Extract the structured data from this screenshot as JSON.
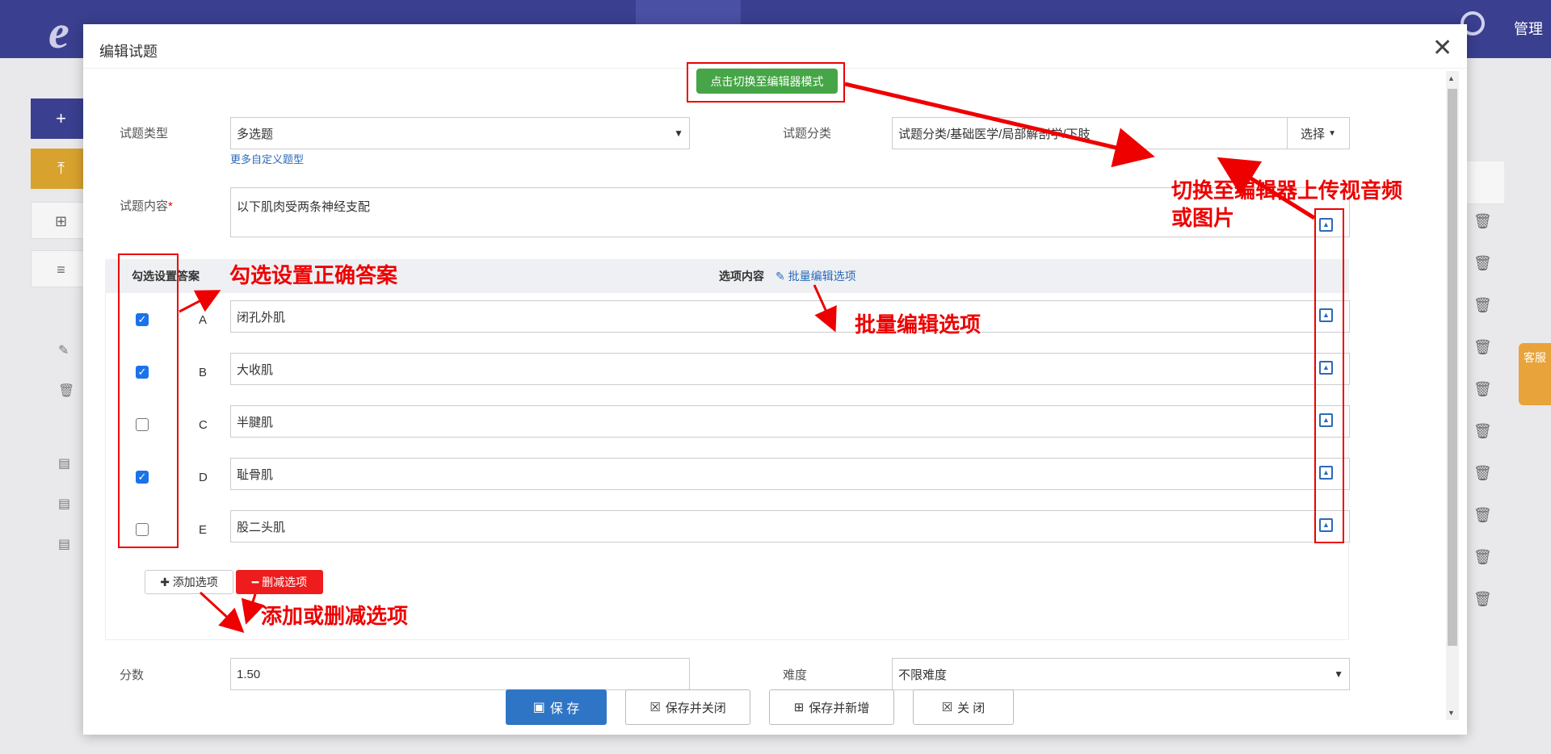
{
  "app": {
    "admin_label": "管理",
    "service_label": "客服",
    "side_buttons": [
      "+",
      "⤒"
    ],
    "side_icons": [
      "⊞",
      "≡"
    ]
  },
  "dialog": {
    "title": "编辑试题",
    "editor_mode_button": "点击切换至编辑器模式",
    "question_type": {
      "label": "试题类型",
      "value": "多选题",
      "more_link": "更多自定义题型"
    },
    "category": {
      "label": "试题分类",
      "value": "试题分类/基础医学/局部解剖学/下肢",
      "choose_button": "选择"
    },
    "content": {
      "label": "试题内容",
      "required_mark": "*",
      "value": "以下肌肉受两条神经支配"
    },
    "options_table": {
      "col_answer": "勾选设置答案",
      "col_content": "选项内容",
      "batch_edit_link": "批量编辑选项",
      "rows": [
        {
          "letter": "A",
          "text": "闭孔外肌",
          "checked": true
        },
        {
          "letter": "B",
          "text": "大收肌",
          "checked": true
        },
        {
          "letter": "C",
          "text": "半腱肌",
          "checked": false
        },
        {
          "letter": "D",
          "text": "耻骨肌",
          "checked": true
        },
        {
          "letter": "E",
          "text": "股二头肌",
          "checked": false
        }
      ]
    },
    "add_option": "添加选项",
    "remove_option": "删减选项",
    "score": {
      "label": "分数",
      "value": "1.50"
    },
    "difficulty": {
      "label": "难度",
      "value": "不限难度"
    },
    "footer": {
      "save": "保 存",
      "save_close": "保存并关闭",
      "save_new": "保存并新增",
      "close": "关 闭"
    }
  },
  "annotations": {
    "set_answer": "勾选设置正确答案",
    "batch_edit": "批量编辑选项",
    "upload_media_line1": "切换至编辑器上传视音频",
    "upload_media_line2": "或图片",
    "add_remove": "添加或删减选项"
  },
  "colors": {
    "nav_bg": "#3a3f8f",
    "primary": "#2f75c6",
    "green": "#46a546",
    "danger": "#ee1c1c",
    "annotation_red": "#e00000",
    "link": "#2b6ab8"
  }
}
